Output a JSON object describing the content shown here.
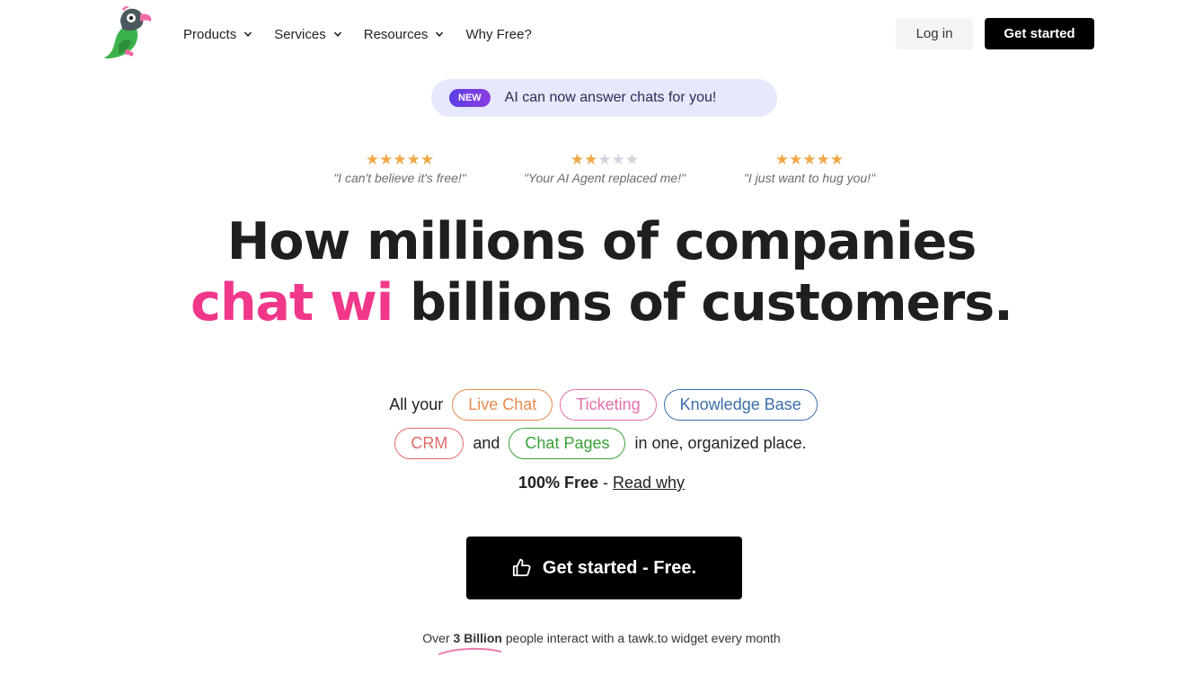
{
  "nav": {
    "items": [
      {
        "label": "Products",
        "has_dropdown": true
      },
      {
        "label": "Services",
        "has_dropdown": true
      },
      {
        "label": "Resources",
        "has_dropdown": true
      },
      {
        "label": "Why Free?",
        "has_dropdown": false
      }
    ],
    "login_label": "Log in",
    "get_started_label": "Get started"
  },
  "announcement": {
    "badge": "NEW",
    "text": "AI can now answer chats for you!"
  },
  "reviews": [
    {
      "rating": 5,
      "quote": "\"I can't believe it's free!\""
    },
    {
      "rating": 2,
      "quote": "\"Your AI Agent replaced me!\""
    },
    {
      "rating": 5,
      "quote": "\"I just want to hug you!\""
    }
  ],
  "headline": {
    "line1": "How millions of companies",
    "line2_highlight": "chat wi",
    "line2_rest": " billions of customers."
  },
  "products": {
    "prefix": "All your",
    "chips": [
      "Live Chat",
      "Ticketing",
      "Knowledge Base",
      "CRM",
      "Chat Pages"
    ],
    "connector": "and",
    "suffix": "in one, organized place."
  },
  "free_line": {
    "bold": "100% Free",
    "sep": " - ",
    "link": "Read why"
  },
  "cta": {
    "label": "Get started - Free."
  },
  "footer": {
    "prefix": "Over ",
    "bold": "3 Billion",
    "suffix": " people interact with a tawk.to widget every month"
  },
  "colors": {
    "accent_pink": "#f0378a",
    "star": "#f0a848",
    "chip_live_chat": "#e88a4e",
    "chip_ticketing": "#e46fa8",
    "chip_knowledge_base": "#3b6ea8",
    "chip_crm": "#e26a6a",
    "chip_chat_pages": "#3aa23a"
  }
}
